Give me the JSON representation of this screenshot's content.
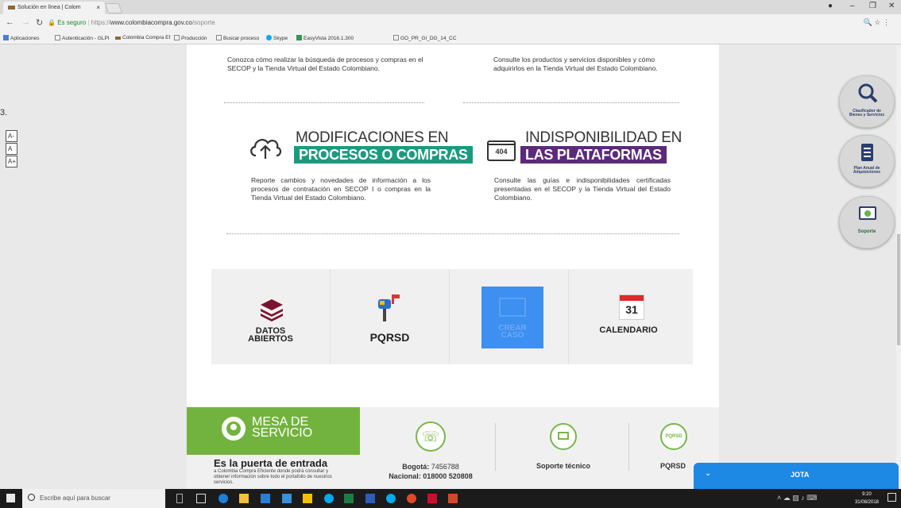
{
  "browser": {
    "tab_title": "Solución en línea | Colom",
    "tab_close": "×",
    "url_secure_label": "Es seguro",
    "url_scheme": "https://",
    "url_host": "www.colombiacompra.gov.co",
    "url_path": "/soporte",
    "bookmarks": [
      "Aplicaciones",
      "Autenticación - GLPI",
      "Colombia Compra Ef",
      "Producción",
      "Buscar proceso",
      "Skype",
      "EasyVista 2016.1.300",
      "GO_PR_GI_DG_14_CC"
    ]
  },
  "page": {
    "stray_char": "3.",
    "font_controls": [
      "A-",
      "A",
      "A+"
    ],
    "intro_left": "Conozca cómo realizar la búsqueda de procesos y compras en el SECOP y la Tienda Virtual del Estado Colombiano.",
    "intro_right": "Consulte los productos y servicios disponibles y cómo adquirirlos en la Tienda Virtual del Estado Colombiano.",
    "feature_left": {
      "title": "MODIFICACIONES EN",
      "banner": "PROCESOS O COMPRAS",
      "text": "Reporte cambios y novedades de información a los procesos de contratación en SECOP I o compras en la Tienda Virtual del Estado Colombiano."
    },
    "feature_right": {
      "title": "INDISPONIBILIDAD EN",
      "banner": "LAS PLATAFORMAS",
      "icon_text": "404",
      "text": "Consulte las guías e indisponibilidades certificadas presentadas en el SECOP y la Tienda Virtual del Estado Colombiano."
    },
    "tiles": [
      {
        "label_1": "DATOS",
        "label_2": "ABIERTOS"
      },
      {
        "label_1": "PQRSD"
      },
      {
        "label_1": "CREAR",
        "label_2": "CASO"
      },
      {
        "label_1": "CALENDARIO",
        "day": "31"
      }
    ],
    "footer": {
      "mesa_title_1": "MESA DE",
      "mesa_title_2": "SERVICIO",
      "heading": "Es la puerta de entrada",
      "subtext": "a Colombia Compra Eficiente donde podrá consultar y obtener información sobre todo el portafolio de nuestros servicios.",
      "bogota_label": "Bogotá:",
      "bogota_value": "7456788",
      "nacional_label": "Nacional:",
      "nacional_value": "018000 520808",
      "soporte_label": "Soporte técnico",
      "pqrsd_label": "PQRSD",
      "pqrsd_icon_text": "PQRSD"
    }
  },
  "side_buttons": [
    {
      "label_1": "Clasificador de",
      "label_2": "Bienes y Servicios"
    },
    {
      "label_1": "Plan Anual de",
      "label_2": "Adquisiciones"
    },
    {
      "label_1": "Soporte",
      "label_2": ""
    }
  ],
  "chat": {
    "title": "JOTA"
  },
  "taskbar": {
    "search_placeholder": "Escribe aquí para buscar",
    "time": "9:20",
    "date": "31/08/2018"
  }
}
